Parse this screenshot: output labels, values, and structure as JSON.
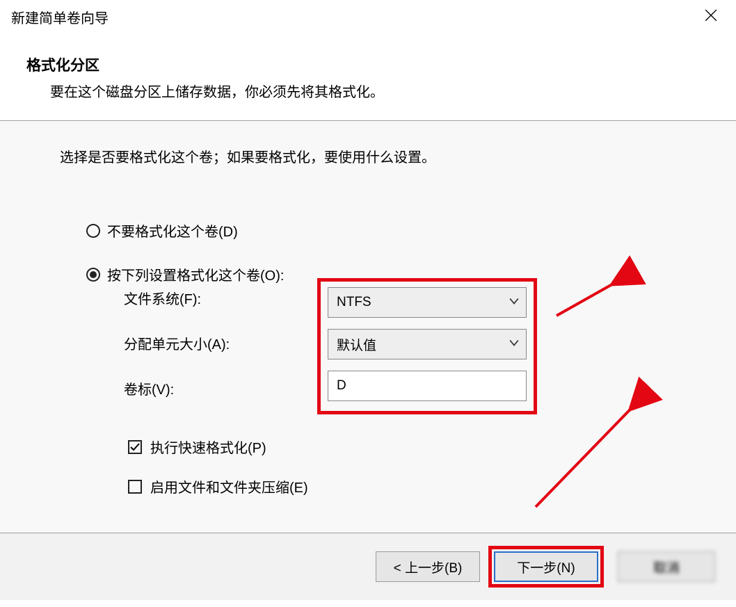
{
  "window": {
    "title": "新建简单卷向导"
  },
  "header": {
    "title": "格式化分区",
    "subtitle": "要在这个磁盘分区上储存数据，你必须先将其格式化。"
  },
  "content": {
    "instruction": "选择是否要格式化这个卷；如果要格式化，要使用什么设置。",
    "radio_no_format": "不要格式化这个卷(D)",
    "radio_format": "按下列设置格式化这个卷(O):",
    "labels": {
      "filesystem": "文件系统(F):",
      "alloc": "分配单元大小(A):",
      "label": "卷标(V):"
    },
    "fields": {
      "filesystem": "NTFS",
      "alloc": "默认值",
      "label": "D"
    },
    "checks": {
      "quick": "执行快速格式化(P)",
      "compress": "启用文件和文件夹压缩(E)"
    }
  },
  "footer": {
    "back": "< 上一步(B)",
    "next": "下一步(N)",
    "cancel": "取消"
  },
  "annotation": {
    "highlight_color": "#e30613"
  }
}
